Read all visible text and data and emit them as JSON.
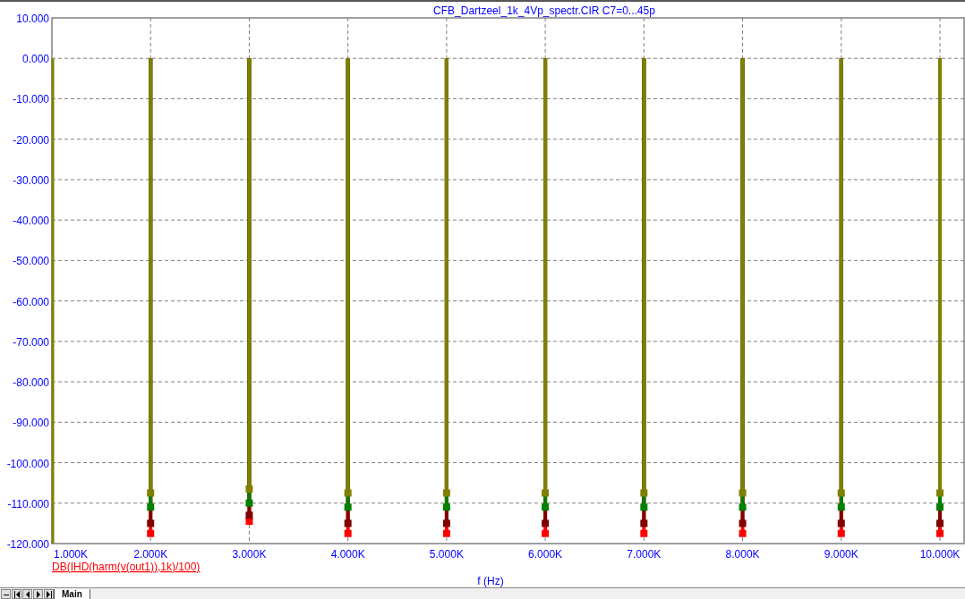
{
  "chart_data": {
    "type": "scatter",
    "title": "CFB_Dartzeel_1k_4Vp_spectr.CIR C7=0...45p",
    "xlabel": "f (Hz)",
    "grid": true,
    "x": [
      2000,
      3000,
      4000,
      5000,
      6000,
      7000,
      8000,
      9000,
      10000
    ],
    "series": [
      {
        "color": "#808000",
        "values": [
          -107.5,
          -106.5,
          -107.5,
          -107.5,
          -107.5,
          -107.5,
          -107.5,
          -107.5,
          -107.5
        ]
      },
      {
        "color": "#008000",
        "values": [
          -111,
          -110,
          -111,
          -111,
          -111,
          -111,
          -111,
          -111,
          -111
        ]
      },
      {
        "color": "#800000",
        "values": [
          -115,
          -113,
          -115,
          -115,
          -115,
          -115,
          -115,
          -115,
          -115
        ]
      },
      {
        "color": "#ff0000",
        "values": [
          -117.5,
          -114.5,
          -117.5,
          -117.5,
          -117.5,
          -117.5,
          -117.5,
          -117.5,
          -117.5
        ]
      }
    ],
    "xlim": [
      1000,
      10000
    ],
    "ylim": [
      -120,
      10
    ],
    "xticks": [
      {
        "value": 1000,
        "label": "1.000K"
      },
      {
        "value": 2000,
        "label": "2.000K"
      },
      {
        "value": 3000,
        "label": "3.000K"
      },
      {
        "value": 4000,
        "label": "4.000K"
      },
      {
        "value": 5000,
        "label": "5.000K"
      },
      {
        "value": 6000,
        "label": "6.000K"
      },
      {
        "value": 7000,
        "label": "7.000K"
      },
      {
        "value": 8000,
        "label": "8.000K"
      },
      {
        "value": 9000,
        "label": "9.000K"
      },
      {
        "value": 10000,
        "label": "10.000K"
      }
    ],
    "yticks": [
      {
        "value": 10,
        "label": "10.000"
      },
      {
        "value": 0,
        "label": "0.000"
      },
      {
        "value": -10,
        "label": "-10.000"
      },
      {
        "value": -20,
        "label": "-20.000"
      },
      {
        "value": -30,
        "label": "-30.000"
      },
      {
        "value": -40,
        "label": "-40.000"
      },
      {
        "value": -50,
        "label": "-50.000"
      },
      {
        "value": -60,
        "label": "-60.000"
      },
      {
        "value": -70,
        "label": "-70.000"
      },
      {
        "value": -80,
        "label": "-80.000"
      },
      {
        "value": -90,
        "label": "-90.000"
      },
      {
        "value": -100,
        "label": "-100.000"
      },
      {
        "value": -110,
        "label": "-110.000"
      },
      {
        "value": -120,
        "label": "-120.000"
      }
    ]
  },
  "curve_expression": "DB(IHD(harm(v(out1)),1k)/100)",
  "tabs": [
    {
      "label": "Main",
      "selected": true
    }
  ]
}
